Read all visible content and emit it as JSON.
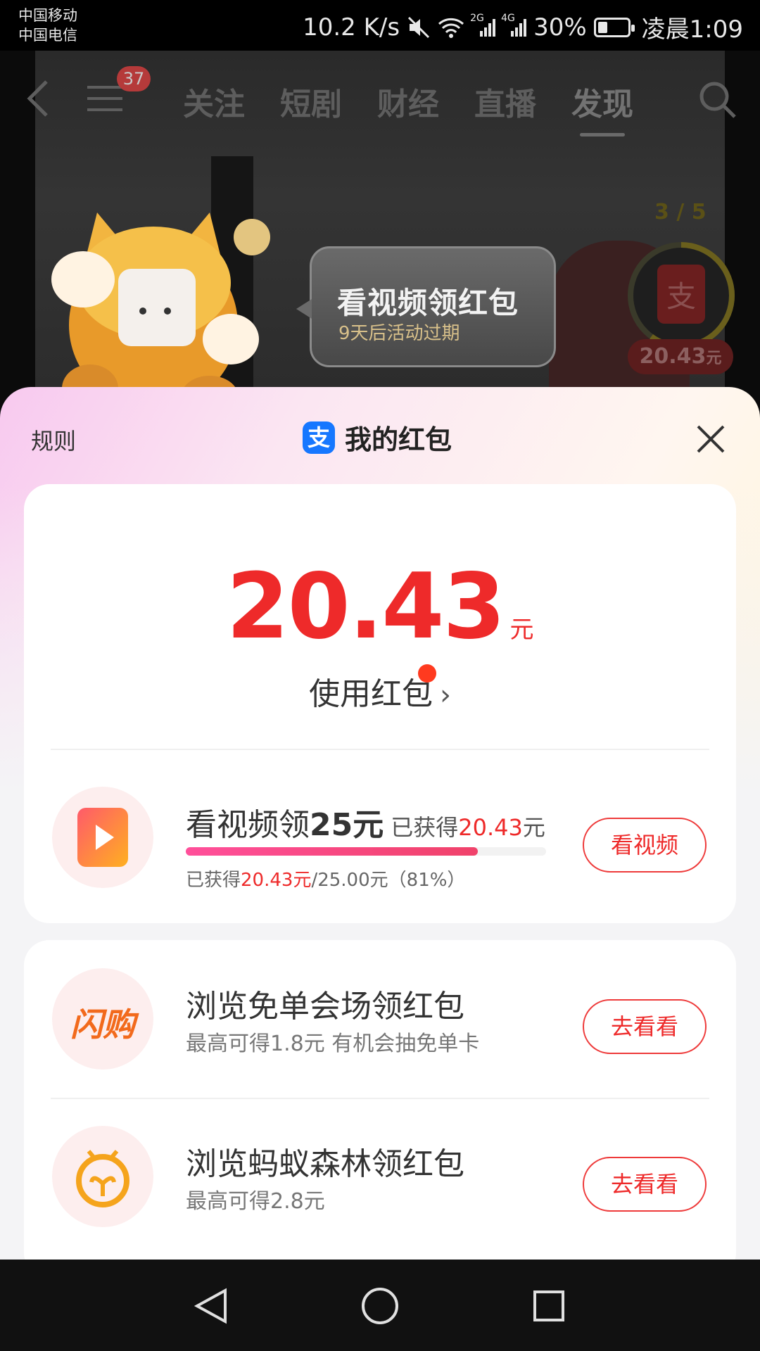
{
  "status_bar": {
    "carrier_1": "中国移动",
    "carrier_2": "中国电信",
    "net_speed": "10.2 K/s",
    "net_2g": "2G",
    "net_4g": "4G",
    "battery": "30%",
    "time": "凌晨1:09"
  },
  "video": {
    "nav_badge": "37",
    "tabs": [
      "关注",
      "短剧",
      "财经",
      "直播",
      "发现"
    ],
    "active_tab": "发现",
    "bubble_title": "看视频领红包",
    "bubble_sub": "9天后活动过期",
    "ring_count": "3 / 5",
    "ring_progress": 0.6,
    "ring_amount": "20.43",
    "ring_amount_unit": "元"
  },
  "sheet": {
    "rules": "规则",
    "title": "我的红包",
    "alipay_glyph": "支",
    "amount": "20.43",
    "amount_unit": "元",
    "use_label": "使用红包"
  },
  "tasks": [
    {
      "title_prefix": "看视频领",
      "title_bold": "25元",
      "earned_prefix": "已获得",
      "earned_value": "20.43",
      "earned_unit": "元",
      "progress": 0.81,
      "progress_prefix": "已获得",
      "progress_value": "20.43元",
      "progress_rest": "/25.00元（81%）",
      "button": "看视频"
    },
    {
      "title": "浏览免单会场领红包",
      "sub": "最高可得1.8元 有机会抽免单卡",
      "icon_text": "闪购",
      "button": "去看看"
    },
    {
      "title": "浏览蚂蚁森林领红包",
      "sub": "最高可得2.8元",
      "button": "去看看"
    }
  ],
  "colors": {
    "accent_red": "#ee2a2a",
    "alipay_blue": "#1677ff",
    "progress_pink": "#f0426a"
  }
}
